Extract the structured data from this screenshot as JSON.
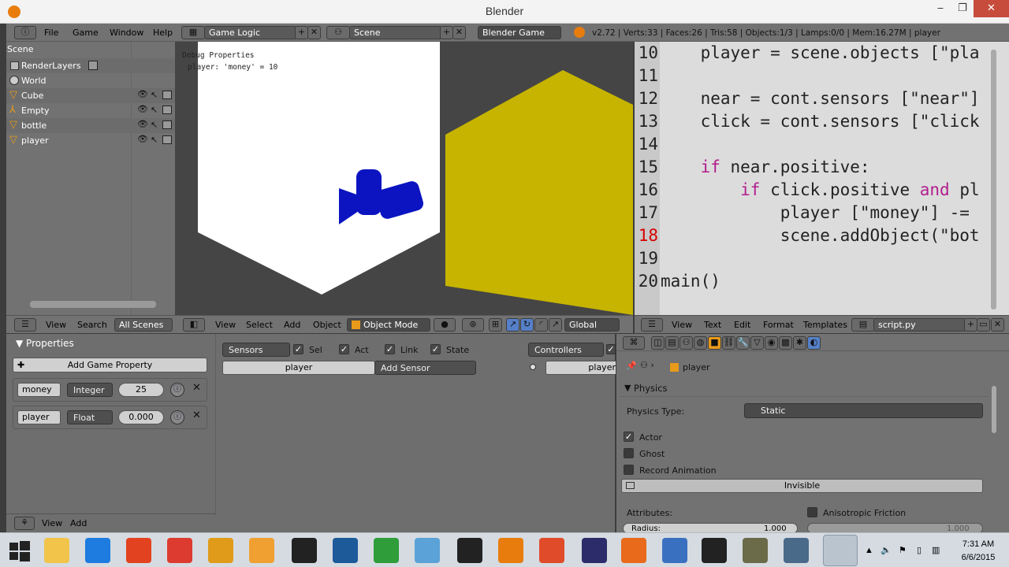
{
  "window": {
    "title": "Blender",
    "minimize": "‒",
    "restore": "❐",
    "close": "✕"
  },
  "info_header": {
    "menus": [
      "File",
      "Game",
      "Window",
      "Help"
    ],
    "screen_layout": "Game Logic",
    "scene": "Scene",
    "engine": "Blender Game",
    "stats": "v2.72 | Verts:33 | Faces:26 | Tris:58 | Objects:1/3 | Lamps:0/0 | Mem:16.27M | player"
  },
  "outliner": {
    "items": [
      {
        "label": "Scene",
        "icon": "scene-icon"
      },
      {
        "label": "RenderLayers",
        "icon": "render-layers-icon"
      },
      {
        "label": "World",
        "icon": "world-icon"
      },
      {
        "label": "Cube",
        "icon": "mesh-object-icon"
      },
      {
        "label": "Empty",
        "icon": "empty-object-icon"
      },
      {
        "label": "bottle",
        "icon": "mesh-object-icon"
      },
      {
        "label": "player",
        "icon": "mesh-object-icon"
      }
    ],
    "header": {
      "view": "View",
      "search": "Search",
      "filter": "All Scenes"
    }
  },
  "viewport": {
    "debug_title": "Debug Properties",
    "debug_line": "player: 'money' = 10",
    "header": {
      "view": "View",
      "select": "Select",
      "add": "Add",
      "object": "Object",
      "mode": "Object Mode",
      "orientation": "Global"
    },
    "colors": {
      "background": "#454545",
      "white_object": "#ffffff",
      "yellow_object": "#c6b400",
      "blue_object": "#0b14c0"
    }
  },
  "text_editor": {
    "lines": [
      {
        "num": "10",
        "code": "    player = scene.objects [\"pla"
      },
      {
        "num": "11",
        "code": ""
      },
      {
        "num": "12",
        "code": "    near = cont.sensors [\"near\"]"
      },
      {
        "num": "13",
        "code": "    click = cont.sensors [\"click"
      },
      {
        "num": "14",
        "code": ""
      },
      {
        "num": "15",
        "code": "    if near.positive:"
      },
      {
        "num": "16",
        "code": "        if click.positive and pl"
      },
      {
        "num": "17",
        "code": "            player [\"money\"] -="
      },
      {
        "num": "18",
        "code": "            scene.addObject(\"bot"
      },
      {
        "num": "19",
        "code": ""
      },
      {
        "num": "20",
        "code": "main()"
      }
    ],
    "header": {
      "view": "View",
      "text": "Text",
      "edit": "Edit",
      "format": "Format",
      "templates": "Templates",
      "filename": "script.py"
    }
  },
  "logic_props": {
    "title": "Properties",
    "add_button": "Add Game Property",
    "properties": [
      {
        "name": "money",
        "type": "Integer",
        "value": "25"
      },
      {
        "name": "player",
        "type": "Float",
        "value": "0.000"
      }
    ],
    "footer": {
      "view": "View",
      "add": "Add"
    }
  },
  "logic_main": {
    "sensors_label": "Sensors",
    "sel": "Sel",
    "act": "Act",
    "link": "Link",
    "state": "State",
    "object_name": "player",
    "add_sensor": "Add Sensor",
    "controllers_label": "Controllers",
    "controller_object": "player"
  },
  "properties_panel": {
    "object": "player",
    "physics_title": "Physics",
    "physics_type_label": "Physics Type:",
    "physics_type": "Static",
    "actor": "Actor",
    "ghost": "Ghost",
    "record_animation": "Record Animation",
    "invisible": "Invisible",
    "attributes": "Attributes:",
    "anisotropic": "Anisotropic Friction",
    "radius_label": "Radius:",
    "radius_value": "1.000",
    "anisotropic_value": "1.000"
  },
  "taskbar": {
    "time": "7:31 AM",
    "date": "6/6/2015",
    "apps": [
      "windows-start-icon",
      "file-explorer-icon",
      "internet-explorer-icon",
      "power-app-icon",
      "chrome-icon",
      "headphones-app-icon",
      "media-player-icon",
      "unity-icon",
      "inkscape-icon",
      "download-app-icon",
      "network-app-icon",
      "obs-icon",
      "blender-icon",
      "colorful-app-icon",
      "eclipse-icon",
      "firefox-icon",
      "remote-desktop-icon",
      "epic-games-icon",
      "gimp-icon",
      "calculator-icon",
      "blender-active-icon"
    ]
  }
}
